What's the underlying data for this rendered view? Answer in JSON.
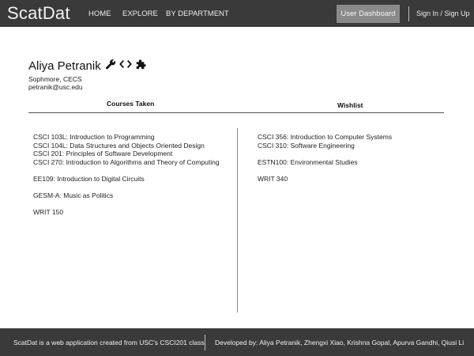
{
  "navbar": {
    "brand": "ScatDat",
    "links": [
      "HOME",
      "EXPLORE",
      "BY DEPARTMENT"
    ],
    "dashboard_button": "User Dashboard",
    "signin": "Sign In / Sign Up",
    "background": "#3a3a3a"
  },
  "profile": {
    "name": "Aliya Petranik",
    "class_info": "Sophmore, CECS",
    "email": "petranik@usc.edu",
    "icons": [
      "wrench-icon",
      "code-icon",
      "puzzle-icon"
    ]
  },
  "tabs": {
    "courses_taken": "Courses Taken",
    "wishlist": "Wishlist"
  },
  "courses_taken": [
    {
      "label": "CSCI 103L: Introduction to Programming",
      "gap": false
    },
    {
      "label": "CSCI 104L: Data Structures and Objects Oriented Design",
      "gap": false
    },
    {
      "label": "CSCI 201: Principles of Software Development",
      "gap": false
    },
    {
      "label": "CSCI 270: Introduction to Algorithms and Theory of Computing",
      "gap": false
    },
    {
      "label": "EE109: Introduction to Digital Circuits",
      "gap": true
    },
    {
      "label": "GESM-A: Music as Politics",
      "gap": true
    },
    {
      "label": "WRIT 150",
      "gap": true
    }
  ],
  "wishlist": [
    {
      "label": "CSCI 356: Introduction to Computer Systems",
      "gap": false
    },
    {
      "label": "CSCI 310: Software Engineering",
      "gap": false
    },
    {
      "label": "ESTN100: Environmental Studies",
      "gap": true
    },
    {
      "label": "WRIT 340",
      "gap": true
    }
  ],
  "footer": {
    "about": "ScatDat is a web application created from USC's CSCI201 class.",
    "developers": "Developed by: Aliya Petranik, Zhengxi Xiao, Krishna Gopal, Apurva Gandhi, Qiusi Li"
  }
}
